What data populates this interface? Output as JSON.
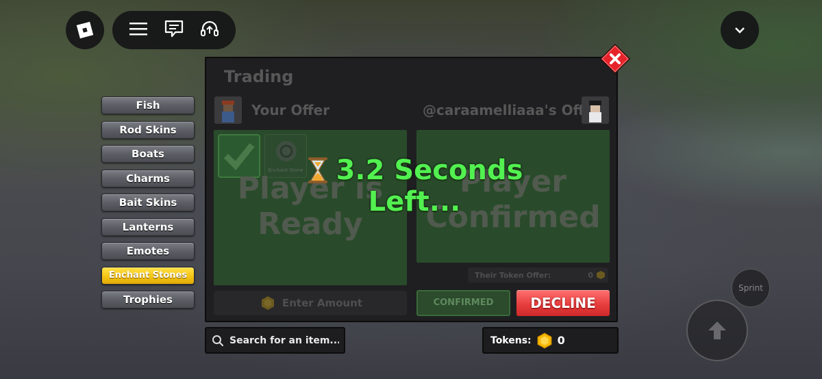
{
  "topbar": {
    "roblox_icon": "roblox-logo-icon",
    "menu_icon": "hamburger-menu-icon",
    "chat_icon": "chat-icon",
    "voice_icon": "headset-icon",
    "collapse_icon": "chevron-down-icon"
  },
  "categories": [
    {
      "label": "Fish",
      "active": false
    },
    {
      "label": "Rod Skins",
      "active": false
    },
    {
      "label": "Boats",
      "active": false
    },
    {
      "label": "Charms",
      "active": false
    },
    {
      "label": "Bait Skins",
      "active": false
    },
    {
      "label": "Lanterns",
      "active": false
    },
    {
      "label": "Emotes",
      "active": false
    },
    {
      "label": "Enchant Stones",
      "active": true
    },
    {
      "label": "Trophies",
      "active": false
    }
  ],
  "trade": {
    "title": "Trading",
    "your_offer_title": "Your Offer",
    "their_offer_title": "@caraamelliaaa's Offer",
    "your_status_text": "Player is Ready",
    "their_status_text": "Player Confirmed",
    "your_item_label": "Enchant Stone",
    "amount_placeholder": "Enter Amount",
    "their_token_label": "Their Token Offer:",
    "their_token_value": "0",
    "confirmed_label": "CONFIRMED",
    "decline_label": "DECLINE",
    "countdown_line1": "3.2 Seconds",
    "countdown_line2": "Left..."
  },
  "search": {
    "placeholder": "Search for an item..."
  },
  "tokens": {
    "label": "Tokens:",
    "value": "0"
  },
  "controls": {
    "sprint_label": "Sprint"
  },
  "colors": {
    "accent_green": "#52f050",
    "decline_red": "#e53a3a",
    "active_category": "#f5c514",
    "close_red": "#e5232b"
  }
}
